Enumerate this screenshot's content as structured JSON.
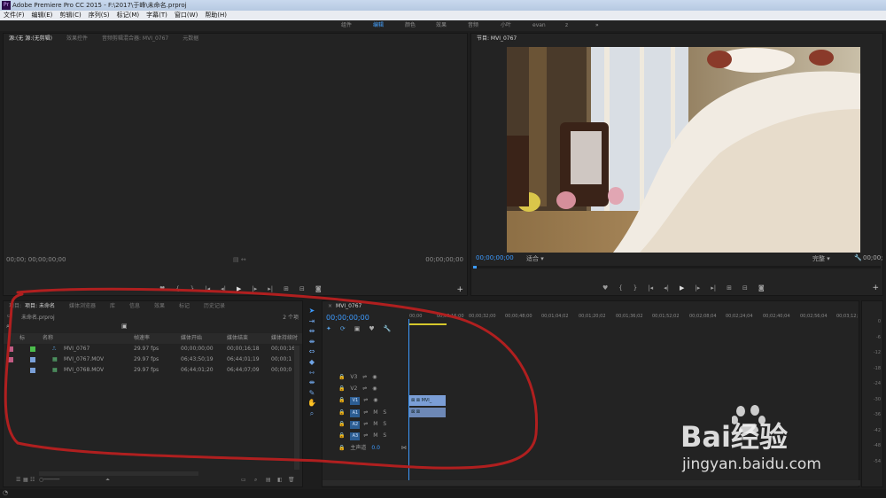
{
  "window": {
    "title": "Adobe Premiere Pro CC 2015 - F:\\2017\\于峰\\未命名.prproj"
  },
  "menubar": {
    "items": [
      "文件(F)",
      "编辑(E)",
      "剪辑(C)",
      "序列(S)",
      "标记(M)",
      "字幕(T)",
      "窗口(W)",
      "帮助(H)"
    ]
  },
  "workspaces": {
    "items": [
      "组件",
      "编辑",
      "颜色",
      "效果",
      "音频",
      "小叶",
      "evan",
      "z"
    ],
    "active": "编辑",
    "more": "»"
  },
  "source_panel": {
    "tabs": [
      "源:(无 源:(无剪辑)",
      "效果控件",
      "音频剪辑混合器: MVI_0767",
      "元数据"
    ],
    "timecode_left": "00;00;  00;00;00;00",
    "timecode_right": "00;00;00;00"
  },
  "program_panel": {
    "tab": "节目: MVI_0767",
    "timecode": "00;00;00;00",
    "fit": "适合",
    "quality": "完整"
  },
  "project_panel": {
    "tabs": [
      "项目: 未命名",
      "媒体浏览器",
      "库",
      "信息",
      "效果",
      "标记",
      "历史记录"
    ],
    "file": "未命名.prproj",
    "item_count": "2 个项",
    "columns": [
      "名称",
      "帧速率",
      "媒体开始",
      "媒体结束",
      "媒体持续时"
    ],
    "items": [
      {
        "name": "MVI_0767",
        "fps": "29.97 fps",
        "start": "00;00;00;00",
        "end": "00;00;16;18",
        "dur": "00;00;16;"
      },
      {
        "name": "MVI_0767.MOV",
        "fps": "29.97 fps",
        "start": "06;43;50;19",
        "end": "06;44;01;19",
        "dur": "00;00;1"
      },
      {
        "name": "MVI_0768.MOV",
        "fps": "29.97 fps",
        "start": "06;44;01;20",
        "end": "06;44;07;09",
        "dur": "00;00;0"
      }
    ]
  },
  "timeline": {
    "tab": "MVI_0767",
    "timecode": "00;00;00;00",
    "ruler": [
      "00;00",
      "00;00;16;00",
      "00;00;32;00",
      "00;00;48;00",
      "00;01;04;02",
      "00;01;20;02",
      "00;01;36;02",
      "00;01;52;02",
      "00;02;08;04",
      "00;02;24;04",
      "00;02;40;04",
      "00;02;56;04",
      "00;03;12;"
    ],
    "tracks": [
      {
        "name": "V3",
        "type": "video"
      },
      {
        "name": "V2",
        "type": "video"
      },
      {
        "name": "V1",
        "type": "video"
      },
      {
        "name": "A1",
        "type": "audio"
      },
      {
        "name": "A2",
        "type": "audio"
      },
      {
        "name": "A3",
        "type": "audio"
      }
    ],
    "master": {
      "label": "主声道",
      "value": "0.0"
    },
    "clip_label": "MVI_"
  },
  "meters": {
    "scale": [
      "0",
      "-6",
      "-12",
      "-18",
      "-24",
      "-30",
      "-36",
      "-42",
      "-48",
      "-54"
    ]
  },
  "watermark": {
    "brand": "Bai经验",
    "url": "jingyan.baidu.com"
  },
  "colors": {
    "accent": "#3d9bff",
    "annotation": "#b01f1f",
    "panel_bg": "#232323"
  }
}
